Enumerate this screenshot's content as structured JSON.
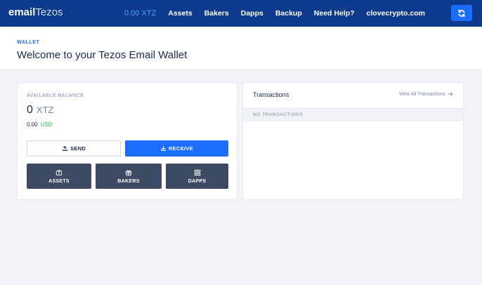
{
  "brand": {
    "part1": "email",
    "part2": "Tezos"
  },
  "nav": {
    "balance": "0.00 XTZ",
    "items": [
      "Assets",
      "Bakers",
      "Dapps",
      "Backup",
      "Need Help?",
      "clovecrypto.com"
    ]
  },
  "header": {
    "breadcrumb": "WALLET",
    "title": "Welcome to your Tezos Email Wallet"
  },
  "wallet": {
    "available_label": "AVAILABLE BALANCE",
    "balance_value": "0",
    "balance_unit": "XTZ",
    "fiat_value": "0.00",
    "fiat_unit": "USD",
    "send_label": "SEND",
    "receive_label": "RECEIVE",
    "tiles": {
      "assets": "ASSETS",
      "bakers": "BAKERS",
      "dapps": "DAPPS"
    }
  },
  "transactions": {
    "title": "Transactions",
    "view_all": "View All Transactions",
    "empty_label": "NO TRANSACTIONS"
  },
  "colors": {
    "topbar": "#0d3a8c",
    "accent": "#1a6dff",
    "tile": "#3d4a63",
    "positive": "#2bb15a",
    "page_bg": "#f1f3f7"
  },
  "icons": [
    "refresh-icon",
    "upload-icon",
    "download-icon",
    "wallet-icon",
    "gift-icon",
    "grid-icon",
    "arrow-right-icon"
  ]
}
